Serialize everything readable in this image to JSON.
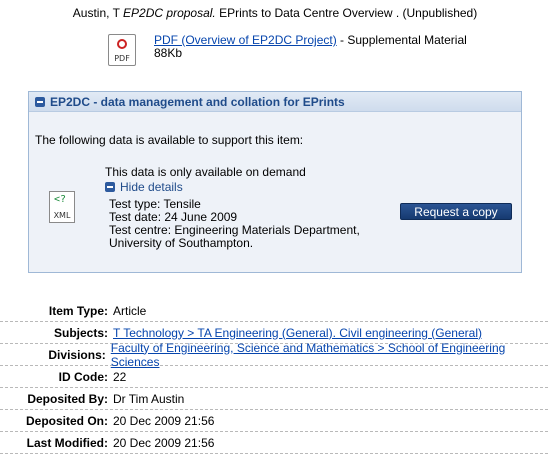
{
  "citation": {
    "prefix": "Austin, T",
    "title": "EP2DC proposal.",
    "rest": "EPrints to Data Centre Overview . (Unpublished)"
  },
  "document": {
    "icon": "pdf-file-icon",
    "link_text": "PDF (Overview of EP2DC Project)",
    "suffix": " - Supplemental Material",
    "size": "88Kb",
    "icon_label": "PDF"
  },
  "panel": {
    "title": "EP2DC - data management and collation for EPrints",
    "intro": "The following data is available to support this item:",
    "demand_note": "This data is only available on demand",
    "hide_details": "Hide details",
    "details": [
      "Test type: Tensile",
      "Test date: 24 June 2009",
      "Test centre: Engineering Materials Department,",
      "University of Southampton."
    ],
    "xml_icon_label": "XML",
    "request_button": "Request a copy"
  },
  "metadata": [
    {
      "key": "Item Type:",
      "value": "Article",
      "link": false
    },
    {
      "key": "Subjects:",
      "value": "T Technology > TA Engineering (General). Civil engineering (General)",
      "link": true
    },
    {
      "key": "Divisions:",
      "value": "Faculty of Engineering, Science and Mathematics > School of Engineering Sciences",
      "link": true
    },
    {
      "key": "ID Code:",
      "value": "22",
      "link": false
    },
    {
      "key": "Deposited By:",
      "value": "Dr Tim Austin",
      "link": false
    },
    {
      "key": "Deposited On:",
      "value": "20 Dec 2009 21:56",
      "link": false
    },
    {
      "key": "Last Modified:",
      "value": "20 Dec 2009 21:56",
      "link": false
    }
  ]
}
